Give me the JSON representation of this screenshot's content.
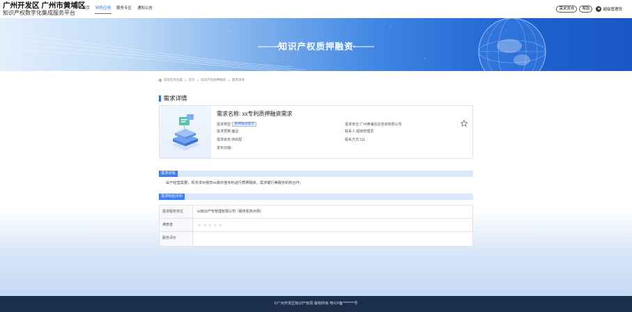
{
  "header": {
    "title": "广州开发区 广州市黄埔区",
    "subtitle": "知识产权数字化集成服务平台",
    "nav": [
      "首页",
      "特色应用",
      "服务专区",
      "通知公告"
    ],
    "nav_active_index": 1,
    "buttons": {
      "publish": "需求发布",
      "help": "帮助"
    },
    "user": "超级管理员"
  },
  "banner": {
    "title": "知识产权质押融资"
  },
  "breadcrumb": {
    "lead": "您现在的位置",
    "items": [
      "首页",
      "知识产权质押融资",
      "需求详情"
    ]
  },
  "section_title": "需求详情",
  "demand": {
    "name_label": "需求名称:",
    "name": "xx专利质押融资需求",
    "type_label": "需求类型:",
    "type": "质押融资需求",
    "budget_label": "需求预算:",
    "budget": "面议",
    "status_label": "需求状态:",
    "status": "待匹配",
    "date_label": "发布日期:",
    "date": "-",
    "org_label": "需求单位:",
    "org": "广州黄埔信息咨询有限公司",
    "contact_label": "联系人:",
    "contact": "超级管理员",
    "phone_label": "联系方式:",
    "phone": "111"
  },
  "details": {
    "label": "需求详情",
    "text": "由于经营需要，现寻求对我司xx高价值专利进行质押融资，需求银行等服务机构合作。"
  },
  "evaluation": {
    "label": "需求响应评价",
    "rows": [
      {
        "label": "需求服务单位",
        "value": "xx知识产权管理有限公司（服务机构示例）"
      },
      {
        "label": "满意度",
        "value": ""
      },
      {
        "label": "服务评价",
        "value": ""
      }
    ],
    "rating": 0,
    "rating_max": 5
  },
  "footer": {
    "text": "©广州开发区知识产权局 版权所有 粤ICP备********号"
  },
  "colors": {
    "accent": "#2f6bff",
    "footer_bg": "#1b2e4c",
    "strip_label": "#3e7cf0"
  }
}
